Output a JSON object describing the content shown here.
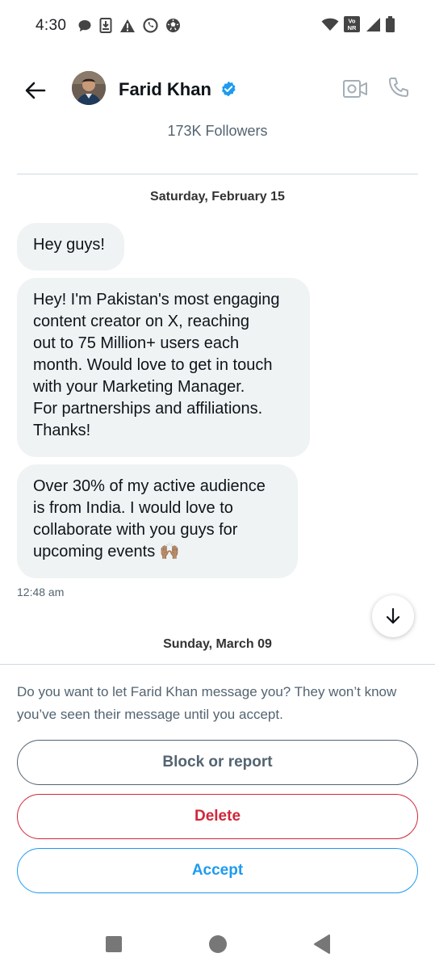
{
  "status_bar": {
    "time": "4:30",
    "left_icons": [
      "chat-bubble-icon",
      "download-icon",
      "warning-icon",
      "whatsapp-icon",
      "soccer-ball-icon"
    ],
    "right_icons": [
      "wifi-icon",
      "volte-icon",
      "signal-icon",
      "battery-icon"
    ],
    "volte_text_top": "Vo",
    "volte_text_bottom": "NR"
  },
  "header": {
    "name": "Farid Khan",
    "verified": true,
    "followers": "173K Followers"
  },
  "conversation": {
    "date_1": "Saturday, February 15",
    "messages": [
      {
        "text": "Hey guys!"
      },
      {
        "text": "Hey! I'm Pakistan's most engaging\ncontent creator on X, reaching\nout to 75 Million+ users each\nmonth. Would love to get in touch\nwith your Marketing Manager.\nFor partnerships and affiliations.\nThanks!"
      },
      {
        "text": "Over 30% of my active audience\nis from India. I would love to\ncollaborate with you guys for\nupcoming events 🙌🏽"
      }
    ],
    "time": "12:48 am",
    "date_2": "Sunday, March 09"
  },
  "request_panel": {
    "prompt": "Do you want to let Farid Khan message you? They won’t know you’ve seen their message until you accept.",
    "block_label": "Block or report",
    "delete_label": "Delete",
    "accept_label": "Accept"
  },
  "colors": {
    "accent": "#1d9bf0",
    "danger": "#d0263a",
    "muted": "#536471",
    "bubble": "#eff3f4"
  }
}
